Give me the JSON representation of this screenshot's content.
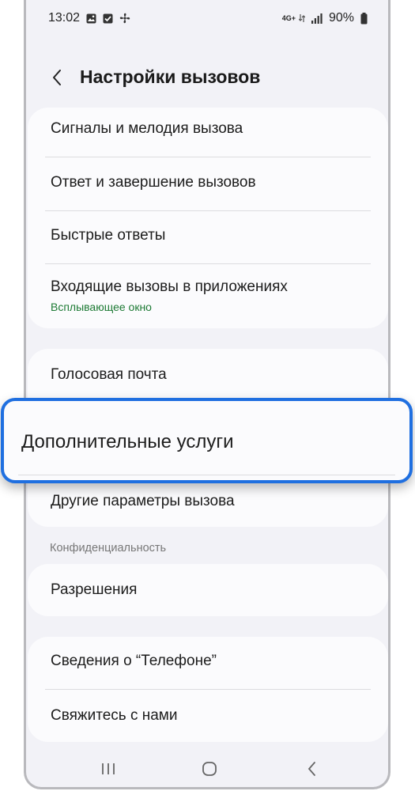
{
  "status_bar": {
    "time": "13:02",
    "network": "4G+",
    "battery": "90%",
    "icons": [
      "gallery-icon",
      "checkbox-icon",
      "fan-icon",
      "data-arrows-icon",
      "signal-icon",
      "battery-icon"
    ]
  },
  "header": {
    "title": "Настройки вызовов"
  },
  "group1": {
    "items": [
      {
        "label": "Сигналы и мелодия вызова"
      },
      {
        "label": "Ответ и завершение вызовов"
      },
      {
        "label": "Быстрые ответы"
      },
      {
        "label": "Входящие вызовы в приложениях",
        "sublabel": "Всплывающее окно"
      }
    ]
  },
  "group2": {
    "items": [
      {
        "label": "Голосовая почта"
      },
      {
        "label": "Дополнительные услуги"
      },
      {
        "label": "Другие параметры вызова"
      }
    ]
  },
  "section_privacy": {
    "label": "Конфиденциальность"
  },
  "group3": {
    "items": [
      {
        "label": "Разрешения"
      }
    ]
  },
  "group4": {
    "items": [
      {
        "label": "Сведения о “Телефоне”"
      },
      {
        "label": "Свяжитесь с нами"
      }
    ]
  },
  "colors": {
    "highlight_border": "#1f6fe0",
    "sublabel_green": "#1d7a34",
    "background": "#f2f2f7",
    "card": "#fbfbfd"
  }
}
